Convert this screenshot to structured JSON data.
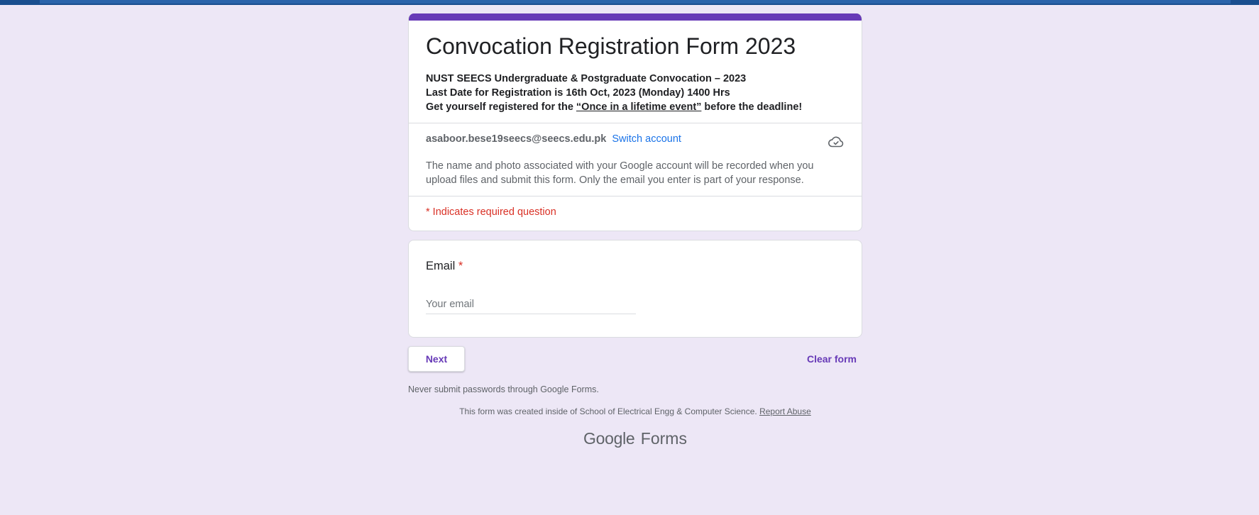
{
  "form": {
    "title": "Convocation Registration Form 2023",
    "description": {
      "line1": "NUST SEECS Undergraduate & Postgraduate Convocation – 2023",
      "line2": "Last Date for Registration is 16th Oct, 2023 (Monday) 1400 Hrs",
      "line3_prefix": "Get yourself registered for the ",
      "line3_underlined": "“Once in a lifetime event”",
      "line3_suffix": " before the deadline!"
    },
    "accent_color": "#673ab7"
  },
  "account": {
    "email": "asaboor.bese19seecs@seecs.edu.pk",
    "switch_label": "Switch account",
    "status_icon": "cloud-check-icon",
    "notice": "The name and photo associated with your Google account will be recorded when you upload files and submit this form. Only the email you enter is part of your response."
  },
  "required_note": "* Indicates required question",
  "question": {
    "label": "Email",
    "required_mark": "*",
    "placeholder": "Your email",
    "value": ""
  },
  "actions": {
    "next_label": "Next",
    "clear_label": "Clear form"
  },
  "footer": {
    "warning": "Never submit passwords through Google Forms.",
    "created_text": "This form was created inside of School of Electrical Engg & Computer Science. ",
    "report_label": "Report Abuse",
    "brand_google": "Google",
    "brand_forms": "Forms"
  }
}
